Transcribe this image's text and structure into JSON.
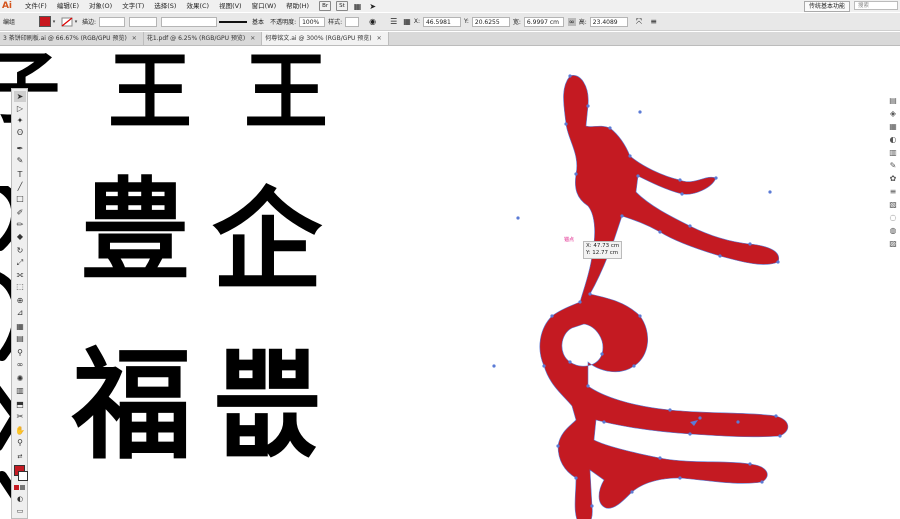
{
  "app": {
    "logo": "Ai"
  },
  "menu": {
    "items": [
      "文件(F)",
      "编辑(E)",
      "对象(O)",
      "文字(T)",
      "选择(S)",
      "效果(C)",
      "视图(V)",
      "窗口(W)",
      "帮助(H)"
    ],
    "badges": [
      "Br",
      "St"
    ],
    "workspace": "传统基本功能",
    "search_placeholder": "搜索"
  },
  "control": {
    "group_label": "编组",
    "stroke_label": "描边:",
    "stroke_style": "基本",
    "opacity_label": "不透明度:",
    "opacity_value": "100%",
    "style_label": "样式:",
    "x_label": "X:",
    "x_value": "46.5981",
    "y_label": "Y:",
    "y_value": "20.6255",
    "w_label": "宽:",
    "w_value": "6.9997",
    "w_unit": "cm",
    "h_label": "高:",
    "h_value": "23.4089",
    "fill_color": "#c8161d"
  },
  "tabs": [
    {
      "label": "3 茶饼印刷板.ai @ 66.67% (RGB/GPU 预览)",
      "active": false
    },
    {
      "label": "花1.pdf @ 6.25% (RGB/GPU 预览)",
      "active": false
    },
    {
      "label": "何尊铭文.ai @ 300% (RGB/GPU 预览)",
      "active": true
    }
  ],
  "canvas": {
    "glyphs": [
      "子",
      "王",
      "王",
      "豊",
      "企",
      "福",
      "쁪"
    ],
    "shape_color": "#c41a22",
    "selection_color": "#5b7bd5",
    "tooltip_x": "X: 47.73 cm",
    "tooltip_y": "Y: 12.77 cm",
    "anchor_label": "锚点"
  },
  "tools": [
    "selection",
    "direct-selection",
    "magic-wand",
    "lasso",
    "pen",
    "add-anchor",
    "type",
    "line",
    "rectangle",
    "paintbrush",
    "pencil",
    "blob-brush",
    "eraser",
    "rotate",
    "scale",
    "width",
    "free-transform",
    "shape-builder",
    "perspective",
    "mesh",
    "gradient",
    "eyedropper",
    "blend",
    "symbol-sprayer",
    "column-graph",
    "artboard",
    "slice",
    "hand",
    "zoom"
  ]
}
